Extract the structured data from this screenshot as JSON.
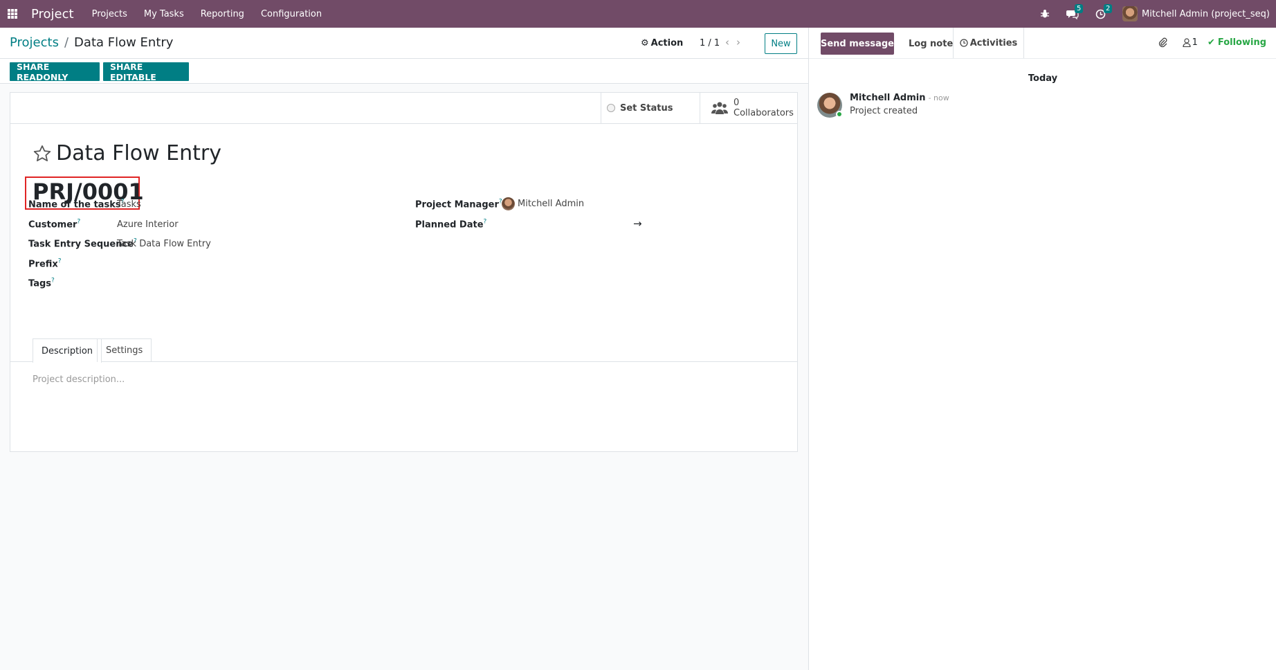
{
  "navbar": {
    "app_name": "Project",
    "menu": [
      "Projects",
      "My Tasks",
      "Reporting",
      "Configuration"
    ],
    "messages_count": "5",
    "activities_count": "2",
    "user": "Mitchell Admin (project_seq)",
    "bg_color": "#714b67"
  },
  "control_panel": {
    "breadcrumb_parent": "Projects",
    "breadcrumb_sep": "/",
    "breadcrumb_current": "Data Flow Entry",
    "action_label": "Action",
    "pager": "1 / 1",
    "new_label": "New"
  },
  "share": {
    "readonly_label": "SHARE READONLY",
    "editable_label": "SHARE EDITABLE"
  },
  "status": {
    "set_status_label": "Set Status",
    "collaborators_count": "0",
    "collaborators_label": "Collaborators"
  },
  "form": {
    "title": "Data Flow Entry",
    "sequence": "PRJ/0001",
    "fields_left": [
      {
        "label": "Name of the tasks",
        "value": "Tasks"
      },
      {
        "label": "Customer",
        "value": "Azure Interior"
      },
      {
        "label": "Task Entry Sequence",
        "value": "Task Data Flow Entry"
      },
      {
        "label": "Prefix",
        "value": ""
      },
      {
        "label": "Tags",
        "value": ""
      }
    ],
    "project_manager_label": "Project Manager",
    "project_manager_value": "Mitchell Admin",
    "planned_date_label": "Planned Date",
    "planned_date_arrow": "→",
    "help_mark": "?",
    "tabs": [
      "Description",
      "Settings"
    ],
    "description_placeholder": "Project description..."
  },
  "chatter": {
    "send_message_label": "Send message",
    "log_note_label": "Log note",
    "activities_label": "Activities",
    "followers_count": "1",
    "following_label": "Following",
    "date_separator": "Today",
    "messages": [
      {
        "author": "Mitchell Admin",
        "time": "- now",
        "text": "Project created"
      }
    ]
  },
  "colors": {
    "primary": "#714b67",
    "accent": "#017e84",
    "following": "#28a745",
    "highlight_box": "#e02424"
  }
}
